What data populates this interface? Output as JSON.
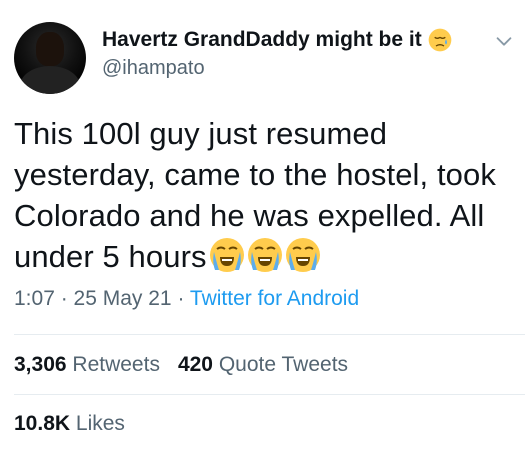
{
  "tweet": {
    "author": {
      "display_name": "Havertz GrandDaddy might be it",
      "handle": "@ihampato",
      "name_emoji": "disappointed-relieved-face",
      "avatar": "profile-photo"
    },
    "text": {
      "line1": "This 100l guy just resumed",
      "line2": "yesterday, came to the hostel, took",
      "line3": "Colorado and he was expelled. All",
      "line4": "under 5 hours",
      "trailing_emojis": [
        "loudly-crying-face",
        "loudly-crying-face",
        "loudly-crying-face"
      ]
    },
    "meta": {
      "time": "1:07",
      "separator1": " · ",
      "date": "25 May 21",
      "separator2": " · ",
      "source": "Twitter for Android"
    },
    "stats": {
      "retweets_count": "3,306",
      "retweets_label": "Retweets",
      "quote_count": "420",
      "quote_label": "Quote Tweets",
      "likes_count": "10.8K",
      "likes_label": "Likes"
    },
    "menu_icon": "chevron-down-icon",
    "colors": {
      "text": "#0f1419",
      "secondary": "#536471",
      "link": "#1d9bf0",
      "divider": "#e6ecf0"
    }
  }
}
